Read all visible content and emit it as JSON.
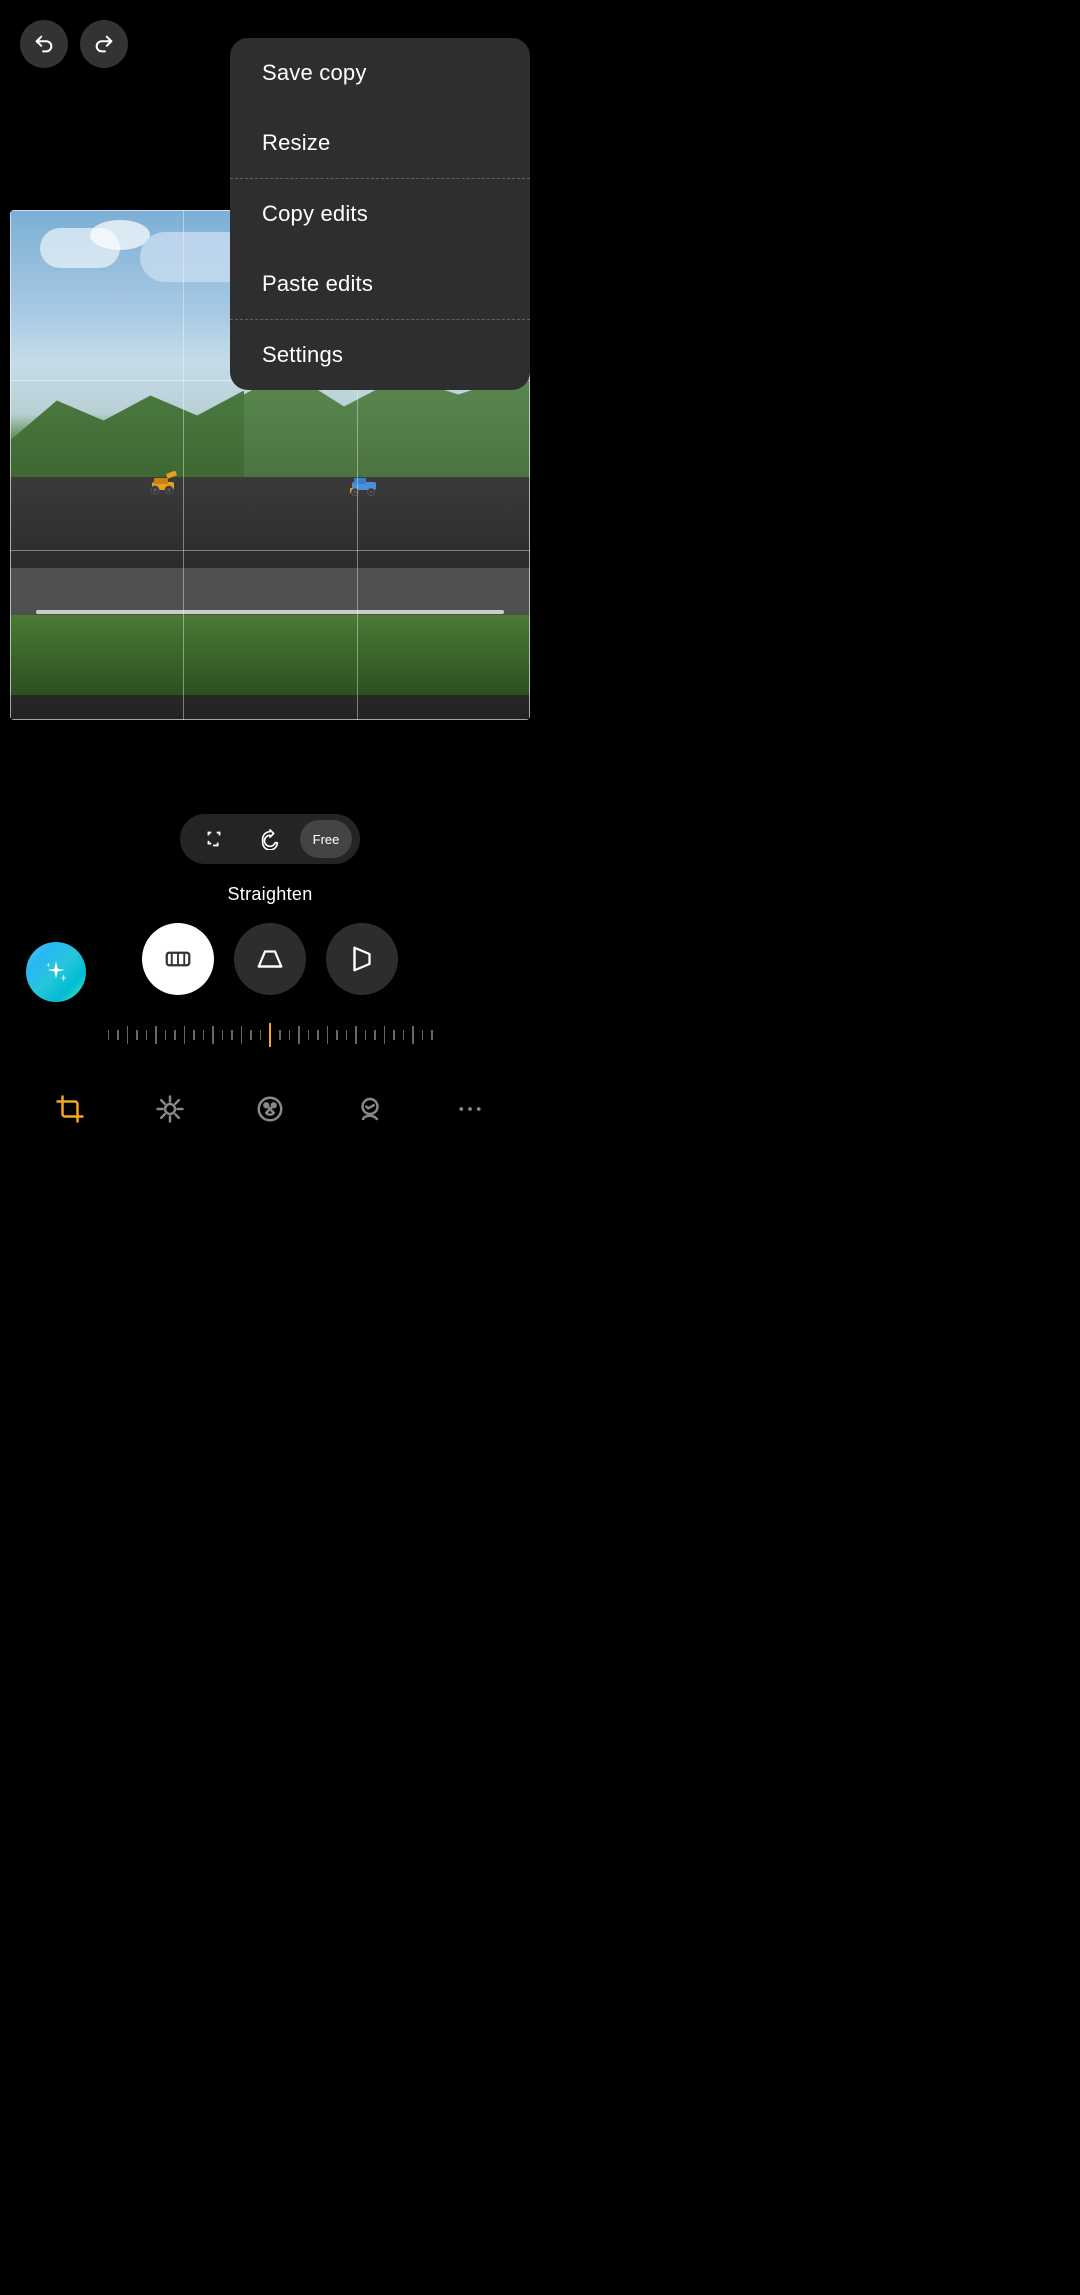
{
  "topbar": {
    "undo_label": "undo",
    "redo_label": "redo"
  },
  "menu": {
    "items": [
      {
        "id": "save-copy",
        "label": "Save copy"
      },
      {
        "id": "resize",
        "label": "Resize"
      },
      {
        "id": "copy-edits",
        "label": "Copy edits"
      },
      {
        "id": "paste-edits",
        "label": "Paste edits"
      },
      {
        "id": "settings",
        "label": "Settings"
      }
    ]
  },
  "tools": {
    "pills": [
      {
        "id": "aspect",
        "label": "aspect"
      },
      {
        "id": "rotate",
        "label": "rotate"
      },
      {
        "id": "free",
        "label": "Free",
        "isText": true
      }
    ]
  },
  "straighten": {
    "label": "Straighten"
  },
  "transform_buttons": [
    {
      "id": "straighten",
      "label": "straighten",
      "active": true
    },
    {
      "id": "perspective-h",
      "label": "perspective-h",
      "active": false
    },
    {
      "id": "perspective-v",
      "label": "perspective-v",
      "active": false
    }
  ],
  "bottom_nav": [
    {
      "id": "crop",
      "label": "crop",
      "active": true
    },
    {
      "id": "adjust",
      "label": "adjust",
      "active": false
    },
    {
      "id": "enhance",
      "label": "enhance",
      "active": false
    },
    {
      "id": "face",
      "label": "face",
      "active": false
    },
    {
      "id": "more",
      "label": "more",
      "active": false
    }
  ],
  "colors": {
    "accent": "#f5a623",
    "active_white": "#ffffff",
    "menu_bg": "#2e2e2e",
    "bg": "#000000"
  }
}
